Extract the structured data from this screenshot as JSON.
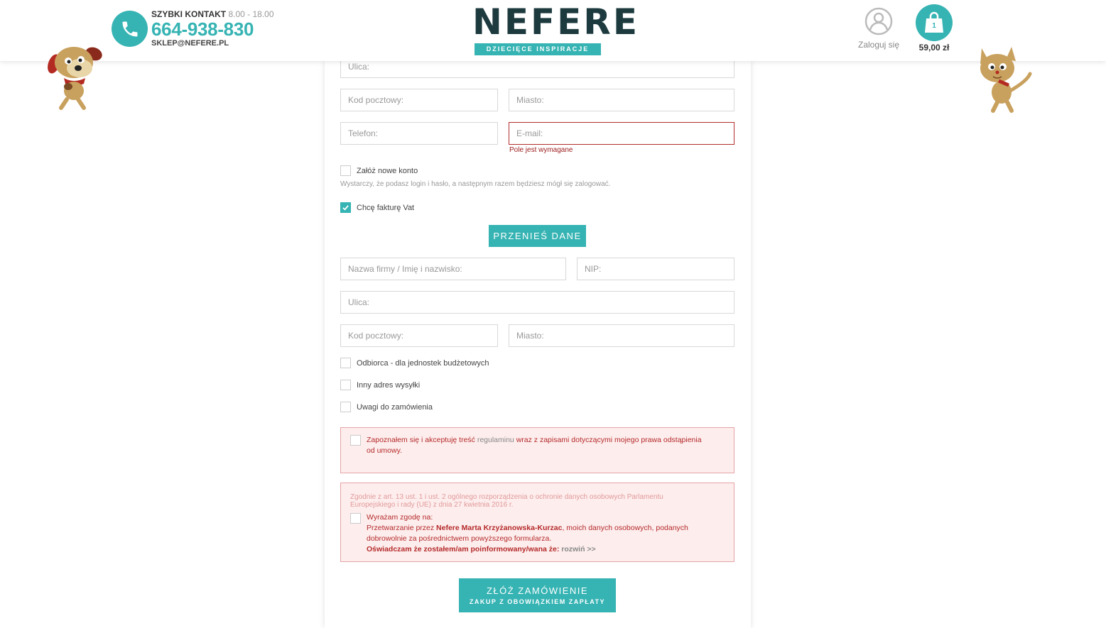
{
  "header": {
    "contact_title": "SZYBKI KONTAKT",
    "contact_hours": "8.00 - 18.00",
    "phone": "664-938-830",
    "email": "SKLEP@NEFERE.PL",
    "logo_text": "NEFERE",
    "logo_tagline": "DZIECIĘCE INSPIRACJE",
    "login_label": "Zaloguj się",
    "cart_count": "1",
    "cart_total": "59,00 zł"
  },
  "form": {
    "street_placeholder": "Ulica:",
    "postcode_placeholder": "Kod pocztowy:",
    "city_placeholder": "Miasto:",
    "phone_placeholder": "Telefon:",
    "email_placeholder": "E-mail:",
    "email_error": "Pole jest wymagane",
    "create_account_label": "Załóż nowe konto",
    "create_account_hint": "Wystarczy, że podasz login i hasło, a następnym razem będziesz mógł się zalogować.",
    "invoice_label": "Chcę fakturę Vat",
    "invoice_checked": true,
    "transfer_button": "PRZENIEŚ DANE",
    "company_placeholder": "Nazwa firmy / Imię i nazwisko:",
    "nip_placeholder": "NIP:",
    "invoice_street_placeholder": "Ulica:",
    "invoice_postcode_placeholder": "Kod pocztowy:",
    "invoice_city_placeholder": "Miasto:",
    "recipient_label": "Odbiorca - dla jednostek budżetowych",
    "other_address_label": "Inny adres wysyłki",
    "notes_label": "Uwagi do zamówienia",
    "terms_text_1": "Zapoznałem się i akceptuję treść",
    "terms_link": "regulaminu",
    "terms_text_2": "wraz z zapisami dotyczącymi mojego prawa odstąpienia",
    "terms_text_3": "od umowy.",
    "rodo_intro_1": "Zgodnie z art. 13 ust. 1 i ust. 2 ogólnego rozporządzenia o ochronie danych osobowych Parlamentu",
    "rodo_intro_2": "Europejskiego i rady (UE) z dnia 27 kwietnia 2016 r.",
    "rodo_consent_1": "Wyrażam zgodę na:",
    "rodo_consent_2a": "Przetwarzanie przez",
    "rodo_company": "Nefere Marta Krzyżanowska-Kurzac",
    "rodo_consent_2b": ", moich danych osobowych, podanych",
    "rodo_consent_3": "dobrowolnie za pośrednictwem powyższego formularza.",
    "rodo_declaration": "Oświadczam że zostałem/am poinformowany/wana że:",
    "rodo_expand": "rozwiń >>",
    "order_button_main": "ZŁÓŻ ZAMÓWIENIE",
    "order_button_sub": "ZAKUP Z OBOWIĄZKIEM ZAPŁATY"
  },
  "colors": {
    "accent": "#36b3b3",
    "error": "#b22d2d",
    "alert_bg": "#fdeded"
  }
}
